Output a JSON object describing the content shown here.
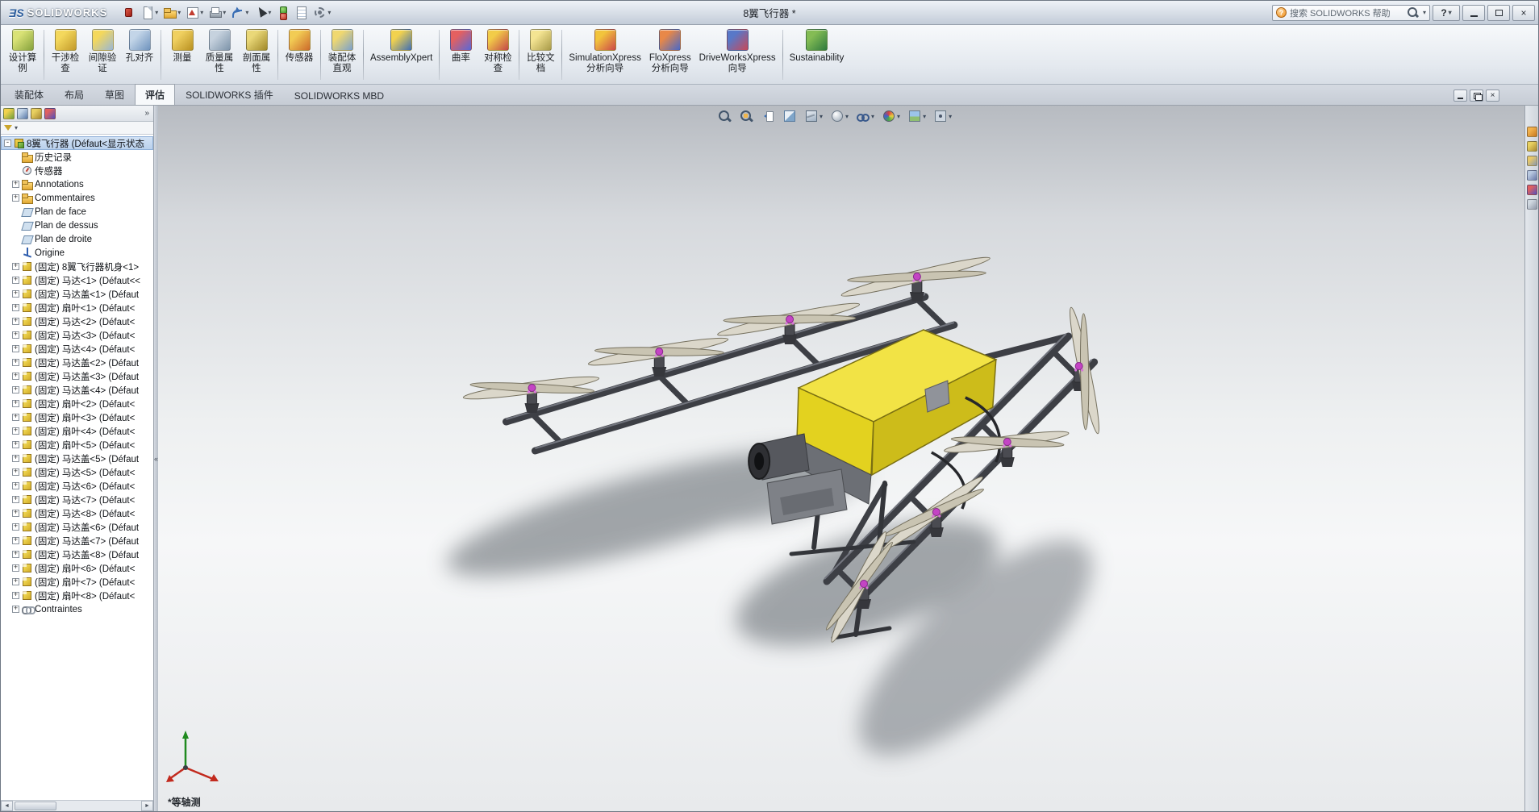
{
  "glyphs": {
    "caret": "▾",
    "overflow": "»",
    "plus": "+",
    "minus": "-",
    "left_arrow": "◄",
    "right_arrow": "►",
    "chevrons": "«",
    "help": "?",
    "close": "×"
  },
  "colors": {
    "body_yellow": "#f2e345",
    "frame_gray": "#3d3f45",
    "prop_gray": "#dbd7ca",
    "motor_pink": "#c444c4",
    "selection_blue": "#c8daf0"
  },
  "titlebar": {
    "logo_mark": "ƎS",
    "logo_text": "SOLIDWORKS",
    "doc_title": "8翼飞行器 *",
    "search_placeholder": "搜索 SOLIDWORKS 帮助",
    "qat": [
      {
        "name": "solidworks-menu",
        "icon": "swmenu"
      },
      {
        "name": "new-document",
        "icon": "page",
        "dropdown": true
      },
      {
        "name": "open",
        "icon": "folder",
        "dropdown": true
      },
      {
        "name": "make-drawing",
        "icon": "drawing",
        "dropdown": true
      },
      {
        "name": "print",
        "icon": "printer",
        "dropdown": true
      },
      {
        "name": "undo",
        "icon": "undo",
        "dropdown": true
      },
      {
        "name": "select",
        "icon": "cursor",
        "dropdown": true
      },
      {
        "name": "rebuild",
        "icon": "rebuild"
      },
      {
        "name": "file-properties",
        "icon": "fileprops"
      },
      {
        "name": "options",
        "icon": "gear",
        "dropdown": true
      }
    ]
  },
  "ribbon": {
    "buttons": [
      {
        "icon": "design-study-icon",
        "label": "设计算\n例",
        "c1": "#d9e276",
        "c2": "#86a23c"
      },
      {
        "sep": true
      },
      {
        "icon": "interference-check-icon",
        "label": "干涉检\n查",
        "c1": "#f4d85c",
        "c2": "#c29a2a"
      },
      {
        "icon": "clearance-verify-icon",
        "label": "间隙验\n证",
        "c1": "#f4d85c",
        "c2": "#9ab6d4"
      },
      {
        "icon": "hole-alignment-icon",
        "label": "孔对齐",
        "c1": "#c3d5e8",
        "c2": "#6f93bd"
      },
      {
        "sep": true
      },
      {
        "icon": "measure-icon",
        "label": "测量",
        "c1": "#f0d060",
        "c2": "#b89020"
      },
      {
        "icon": "mass-properties-icon",
        "label": "质量属\n性",
        "c1": "#c6d2de",
        "c2": "#7e94aa"
      },
      {
        "icon": "section-properties-icon",
        "label": "剖面属\n性",
        "c1": "#ead878",
        "c2": "#a08828"
      },
      {
        "sep": true
      },
      {
        "icon": "sensor-icon",
        "label": "传感器",
        "c1": "#f2cc54",
        "c2": "#cc6a2a"
      },
      {
        "sep": true
      },
      {
        "icon": "assembly-visualization-icon",
        "label": "装配体\n直观",
        "c1": "#f0d870",
        "c2": "#7aa0cc"
      },
      {
        "sep": true
      },
      {
        "icon": "assemblyxpert-icon",
        "label": "AssemblyXpert",
        "c1": "#f2d24e",
        "c2": "#3e6eb4"
      },
      {
        "sep": true
      },
      {
        "icon": "curvature-icon",
        "label": "曲率",
        "c1": "#e46060",
        "c2": "#5868d8"
      },
      {
        "icon": "symmetry-check-icon",
        "label": "对称检\n查",
        "c1": "#f2cc48",
        "c2": "#c44848"
      },
      {
        "sep": true
      },
      {
        "icon": "compare-documents-icon",
        "label": "比较文\n档",
        "c1": "#f4e492",
        "c2": "#a89a48"
      },
      {
        "sep": true
      },
      {
        "icon": "simulationxpress-icon",
        "label": "SimulationXpress\n分析向导",
        "c1": "#f2c43c",
        "c2": "#cc4848"
      },
      {
        "icon": "floxpress-icon",
        "label": "FloXpress\n分析向导",
        "c1": "#e88848",
        "c2": "#4868c8"
      },
      {
        "icon": "driveworksxpress-icon",
        "label": "DriveWorksXpress\n向导",
        "c1": "#5878c8",
        "c2": "#c84858"
      },
      {
        "sep": true
      },
      {
        "icon": "sustainability-icon",
        "label": "Sustainability",
        "c1": "#84bc54",
        "c2": "#2e7a3e"
      }
    ]
  },
  "command_tabs": [
    {
      "id": "assembly",
      "label": "装配体"
    },
    {
      "id": "layout",
      "label": "布局"
    },
    {
      "id": "sketch",
      "label": "草图"
    },
    {
      "id": "evaluate",
      "label": "评估",
      "active": true
    },
    {
      "id": "addins",
      "label": "SOLIDWORKS 插件"
    },
    {
      "id": "mbd",
      "label": "SOLIDWORKS MBD"
    }
  ],
  "viewport": {
    "view_label": "*等轴测",
    "toolbar": [
      {
        "name": "zoom-fit",
        "icon": "magnifier"
      },
      {
        "name": "zoom-area",
        "icon": "magarea"
      },
      {
        "name": "previous-view",
        "icon": "prev"
      },
      {
        "name": "section-view",
        "icon": "section"
      },
      {
        "name": "view-orientation",
        "icon": "cube",
        "dropdown": true
      },
      {
        "name": "display-style",
        "icon": "style",
        "dropdown": true
      },
      {
        "name": "hide-show-items",
        "icon": "glasses",
        "dropdown": true
      },
      {
        "name": "edit-appearance",
        "icon": "ball",
        "dropdown": true
      },
      {
        "name": "apply-scene",
        "icon": "scene",
        "dropdown": true
      },
      {
        "name": "view-settings",
        "icon": "settings",
        "dropdown": true
      }
    ]
  },
  "feature_panel": {
    "tabs": [
      {
        "name": "feature-manager-tree",
        "c1": "#f2d24e",
        "c2": "#6f9f3c"
      },
      {
        "name": "property-manager",
        "c1": "#c3d5e8",
        "c2": "#5878a8"
      },
      {
        "name": "configuration-manager",
        "c1": "#e8d060",
        "c2": "#a88830"
      },
      {
        "name": "display-manager",
        "c1": "#e06060",
        "c2": "#5050c0"
      }
    ],
    "items": [
      {
        "label": "8翼飞行器 (Défaut<显示状态",
        "icon": "assembly",
        "exp": "-",
        "selected": true,
        "root": true
      },
      {
        "label": "历史记录",
        "icon": "history"
      },
      {
        "label": "传感器",
        "icon": "sensors"
      },
      {
        "label": "Annotations",
        "icon": "annotations",
        "exp": "+"
      },
      {
        "label": "Commentaires",
        "icon": "comments",
        "exp": "+"
      },
      {
        "label": "Plan de face",
        "icon": "plane"
      },
      {
        "label": "Plan de dessus",
        "icon": "plane"
      },
      {
        "label": "Plan de droite",
        "icon": "plane"
      },
      {
        "label": "Origine",
        "icon": "origin"
      },
      {
        "label": "(固定) 8翼飞行器机身<1>",
        "icon": "component",
        "exp": "+"
      },
      {
        "label": "(固定) 马达<1> (Défaut<<",
        "icon": "component",
        "exp": "+"
      },
      {
        "label": "(固定) 马达盖<1> (Défaut",
        "icon": "component",
        "exp": "+"
      },
      {
        "label": "(固定) 扇叶<1> (Défaut<",
        "icon": "component",
        "exp": "+"
      },
      {
        "label": "(固定) 马达<2> (Défaut<",
        "icon": "component",
        "exp": "+"
      },
      {
        "label": "(固定) 马达<3> (Défaut<",
        "icon": "component",
        "exp": "+"
      },
      {
        "label": "(固定) 马达<4> (Défaut<",
        "icon": "component",
        "exp": "+"
      },
      {
        "label": "(固定) 马达盖<2> (Défaut",
        "icon": "component",
        "exp": "+"
      },
      {
        "label": "(固定) 马达盖<3> (Défaut",
        "icon": "component",
        "exp": "+"
      },
      {
        "label": "(固定) 马达盖<4> (Défaut",
        "icon": "component",
        "exp": "+"
      },
      {
        "label": "(固定) 扇叶<2> (Défaut<",
        "icon": "component",
        "exp": "+"
      },
      {
        "label": "(固定) 扇叶<3> (Défaut<",
        "icon": "component",
        "exp": "+"
      },
      {
        "label": "(固定) 扇叶<4> (Défaut<",
        "icon": "component",
        "exp": "+"
      },
      {
        "label": "(固定) 扇叶<5> (Défaut<",
        "icon": "component",
        "exp": "+"
      },
      {
        "label": "(固定) 马达盖<5> (Défaut",
        "icon": "component",
        "exp": "+"
      },
      {
        "label": "(固定) 马达<5> (Défaut<",
        "icon": "component",
        "exp": "+"
      },
      {
        "label": "(固定) 马达<6> (Défaut<",
        "icon": "component",
        "exp": "+"
      },
      {
        "label": "(固定) 马达<7> (Défaut<",
        "icon": "component",
        "exp": "+"
      },
      {
        "label": "(固定) 马达<8> (Défaut<",
        "icon": "component",
        "exp": "+"
      },
      {
        "label": "(固定) 马达盖<6> (Défaut",
        "icon": "component",
        "exp": "+"
      },
      {
        "label": "(固定) 马达盖<7> (Défaut",
        "icon": "component",
        "exp": "+"
      },
      {
        "label": "(固定) 马达盖<8> (Défaut",
        "icon": "component",
        "exp": "+"
      },
      {
        "label": "(固定) 扇叶<6> (Défaut<",
        "icon": "component",
        "exp": "+"
      },
      {
        "label": "(固定) 扇叶<7> (Défaut<",
        "icon": "component",
        "exp": "+"
      },
      {
        "label": "(固定) 扇叶<8> (Défaut<",
        "icon": "component",
        "exp": "+"
      },
      {
        "label": "Contraintes",
        "icon": "mates",
        "exp": "+"
      }
    ]
  },
  "task_pane": {
    "icons": [
      {
        "name": "solidworks-resources-icon",
        "c1": "#f2b24c",
        "c2": "#c87820"
      },
      {
        "name": "design-library-icon",
        "c1": "#e8d060",
        "c2": "#a88830"
      },
      {
        "name": "file-explorer-icon",
        "c1": "#e8c868",
        "c2": "#8898b0"
      },
      {
        "name": "view-palette-icon",
        "c1": "#b8c8e0",
        "c2": "#6878a8"
      },
      {
        "name": "appearances-icon",
        "c1": "#e06060",
        "c2": "#5050c0"
      },
      {
        "name": "custom-properties-icon",
        "c1": "#d0d8e0",
        "c2": "#9098a8"
      }
    ]
  }
}
